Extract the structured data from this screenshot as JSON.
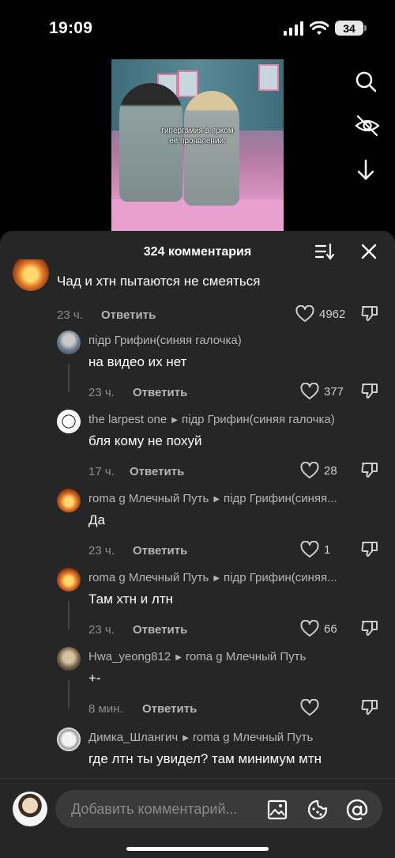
{
  "status_bar": {
    "time": "19:09",
    "battery": "34"
  },
  "video": {
    "caption_line1": "гипергамия в ярком",
    "caption_line2": "её проявлении:"
  },
  "side_icons": [
    "search-icon",
    "eye-off-icon",
    "download-icon"
  ],
  "sheet": {
    "title": "324 комментария"
  },
  "comments": [
    {
      "user": "",
      "reply_to": "",
      "text": "Чад и хтн пытаются не смеяться",
      "time": "23 ч.",
      "reply_label": "Ответить",
      "likes": "4962",
      "avatar": "fire"
    },
    {
      "user": "пiдр Грифин(синяя галочка)",
      "reply_to": "",
      "text": "на видео их нет",
      "time": "23 ч.",
      "reply_label": "Ответить",
      "likes": "377",
      "avatar": "griffin"
    },
    {
      "user": "the larpest one",
      "reply_to": "пiдр Грифин(синяя галочка)",
      "text": "бля кому не похуй",
      "time": "17 ч.",
      "reply_label": "Ответить",
      "likes": "28",
      "avatar": "manga"
    },
    {
      "user": "roma g Млечный Путь",
      "reply_to": "пiдр Грифин(синяя...",
      "text": "Да",
      "time": "23 ч.",
      "reply_label": "Ответить",
      "likes": "1",
      "avatar": "fire"
    },
    {
      "user": "roma g Млечный Путь",
      "reply_to": "пiдр Грифин(синяя...",
      "text": "Там хтн и лтн",
      "time": "23 ч.",
      "reply_label": "Ответить",
      "likes": "66",
      "avatar": "fire"
    },
    {
      "user": "Hwa_yeong812",
      "reply_to": "roma g Млечный Путь",
      "text": "+-",
      "time": "8 мин.",
      "reply_label": "Ответить",
      "likes": "",
      "avatar": "photo"
    },
    {
      "user": "Димка_Шлангич",
      "reply_to": "roma g Млечный Путь",
      "text": "где лтн ты увидел? там минимум мтн",
      "time": "",
      "reply_label": "",
      "likes": "",
      "avatar": "sketch"
    }
  ],
  "input": {
    "placeholder": "Добавить комментарий..."
  },
  "colors": {
    "sheet_bg": "#262626",
    "input_bg": "#3a3a3a",
    "meta": "#8e8e8e"
  }
}
